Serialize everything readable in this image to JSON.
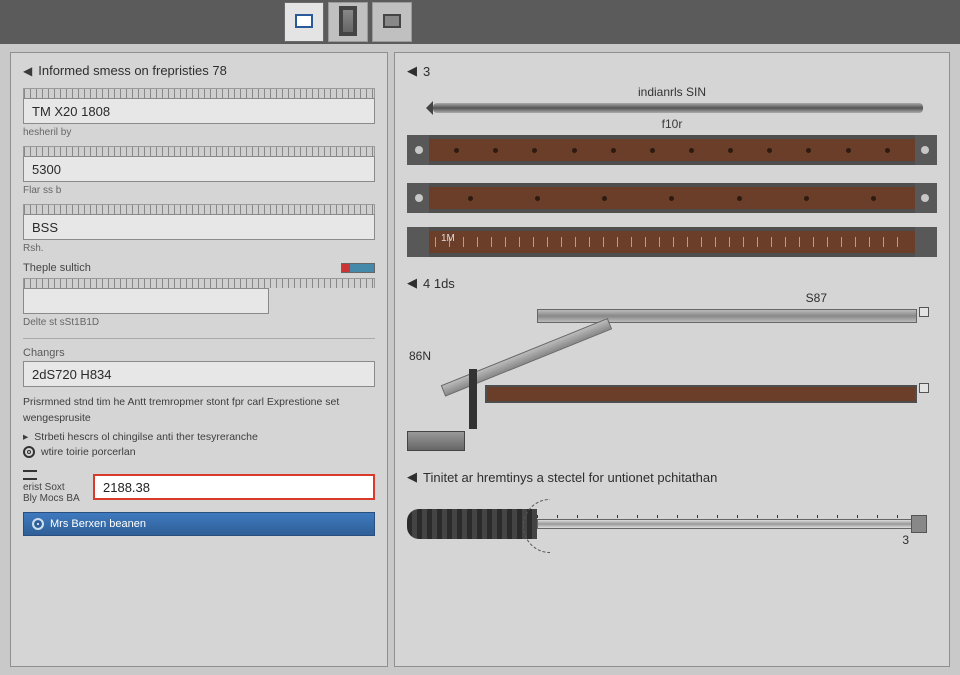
{
  "toolbar": {
    "btn1": "",
    "btn2": "",
    "btn3": ""
  },
  "left": {
    "header": "Informed smess on frepristies  78",
    "f1": {
      "tick": true,
      "value": "TM X20 1808",
      "sub": "hesheril by"
    },
    "f2": {
      "tick": true,
      "value": "5300",
      "sub": "Flar ss b"
    },
    "f3": {
      "tick": true,
      "value": "BSS",
      "sub": "Rsh."
    },
    "f4": {
      "label": "Theple sultich",
      "sub": "Delte st sSt1B1D"
    },
    "changes": "Changrs",
    "f5": {
      "value": "2dS720 H834"
    },
    "note1": "Prisrmned stnd tim he Antt tremropmer stont fpr carl Exprestione set",
    "note2": "wengesprusite",
    "bullet1": "Strbeti hescrs ol chingilse anti ther tesyreranche",
    "bullet2": "wtire toirie porcerlan",
    "sort_label1": "erist Soxt",
    "sort_label2": "Bly Mocs BA",
    "sort_value": "2188.38",
    "toggle": "Mrs Berxen beanen"
  },
  "right": {
    "sec1": {
      "head": "3",
      "top_label": "indianrls SIN",
      "scale": "f10r"
    },
    "sec2": {
      "mark": "1M"
    },
    "sec3": {
      "head": "4 1ds",
      "dim_top": "S87",
      "dim_mid": "86N"
    },
    "sec4": {
      "head": "Tinitet ar hremtinys a stectel for untionet pchitathan",
      "num": "3"
    }
  }
}
